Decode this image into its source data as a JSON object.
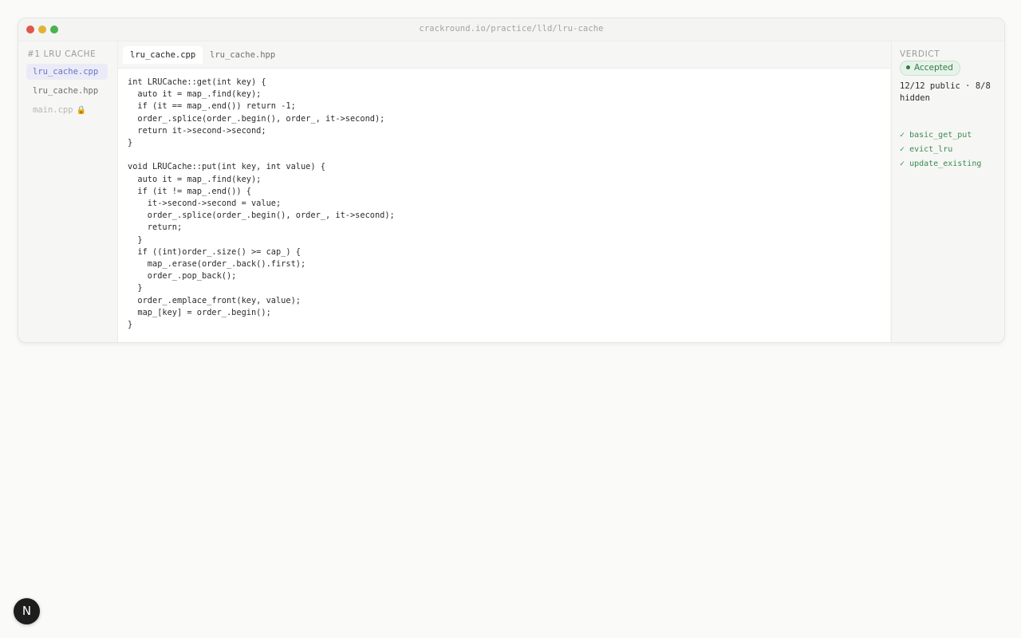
{
  "window": {
    "url": "crackround.io/practice/lld/lru-cache"
  },
  "sidebar": {
    "title": "#1 LRU CACHE",
    "items": [
      {
        "label": "lru_cache.cpp"
      },
      {
        "label": "lru_cache.hpp"
      },
      {
        "label": "main.cpp",
        "icon": "lock-icon",
        "glyph": "🔒"
      }
    ]
  },
  "tabs": [
    {
      "label": "lru_cache.cpp"
    },
    {
      "label": "lru_cache.hpp"
    }
  ],
  "editor": {
    "code": "int LRUCache::get(int key) {\n  auto it = map_.find(key);\n  if (it == map_.end()) return -1;\n  order_.splice(order_.begin(), order_, it->second);\n  return it->second->second;\n}\n\nvoid LRUCache::put(int key, int value) {\n  auto it = map_.find(key);\n  if (it != map_.end()) {\n    it->second->second = value;\n    order_.splice(order_.begin(), order_, it->second);\n    return;\n  }\n  if ((int)order_.size() >= cap_) {\n    map_.erase(order_.back().first);\n    order_.pop_back();\n  }\n  order_.emplace_front(key, value);\n  map_[key] = order_.begin();\n}"
  },
  "verdict": {
    "label": "VERDICT",
    "status": "Accepted",
    "summary": "12/12 public · 8/8 hidden",
    "tests": [
      {
        "mark": "✓",
        "name": "basic_get_put"
      },
      {
        "mark": "✓",
        "name": "evict_lru"
      },
      {
        "mark": "✓",
        "name": "update_existing"
      }
    ]
  },
  "fab": {
    "label": "N"
  }
}
